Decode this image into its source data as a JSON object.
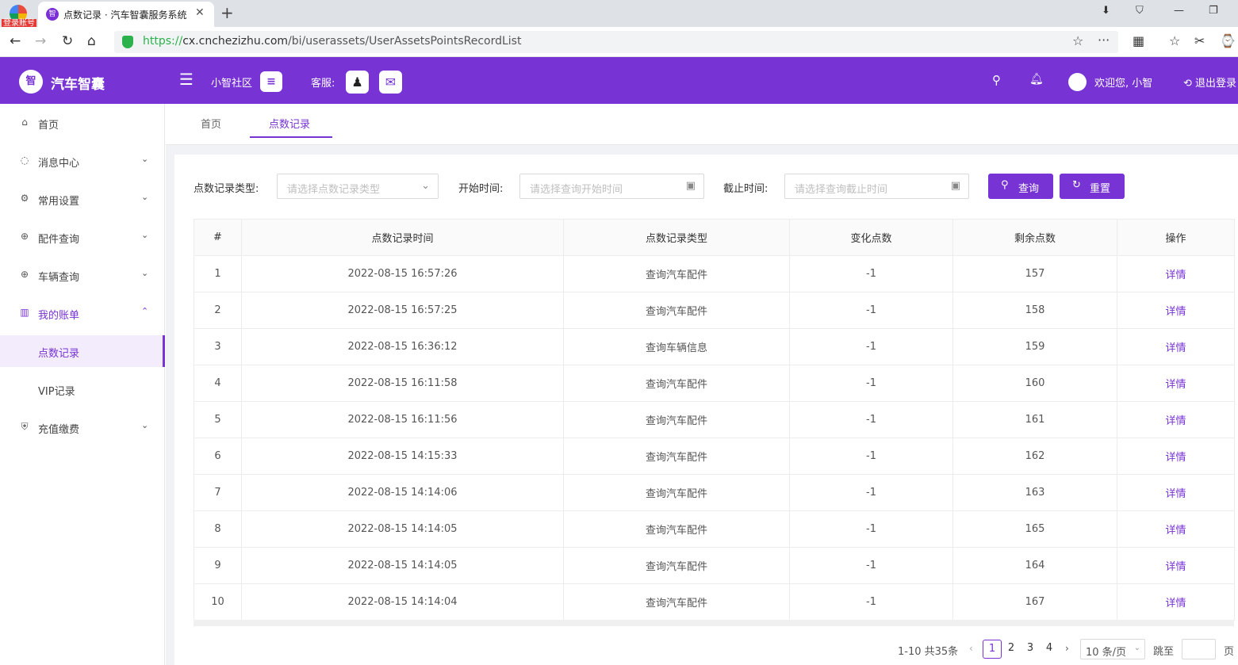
{
  "browser": {
    "login_tag": "登录账号",
    "tab_title": "点数记录 · 汽车智囊服务系统",
    "url_scheme": "https://",
    "url_host": "cx.cnchezizhu.com",
    "url_path": "/bi/userassets/UserAssetsPointsRecordList"
  },
  "header": {
    "logo_text": "智",
    "app_name": "汽车智囊",
    "community": "小智社区",
    "service": "客服:",
    "welcome": "欢迎您, 小智",
    "logout": "退出登录"
  },
  "sidebar": {
    "items": [
      {
        "label": "首页",
        "icon": "home-icon"
      },
      {
        "label": "消息中心",
        "icon": "message-icon"
      },
      {
        "label": "常用设置",
        "icon": "gear-icon"
      },
      {
        "label": "配件查询",
        "icon": "search-plus-icon"
      },
      {
        "label": "车辆查询",
        "icon": "search-plus-icon"
      },
      {
        "label": "我的账单",
        "icon": "bar-chart-icon"
      },
      {
        "label": "点数记录"
      },
      {
        "label": "VIP记录"
      },
      {
        "label": "充值缴费",
        "icon": "shield-icon"
      }
    ]
  },
  "tabs": {
    "home": "首页",
    "current": "点数记录"
  },
  "filters": {
    "type_label": "点数记录类型:",
    "type_placeholder": "请选择点数记录类型",
    "start_label": "开始时间:",
    "start_placeholder": "请选择查询开始时间",
    "end_label": "截止时间:",
    "end_placeholder": "请选择查询截止时间",
    "search_btn": "查询",
    "reset_btn": "重置"
  },
  "table": {
    "headers": [
      "#",
      "点数记录时间",
      "点数记录类型",
      "变化点数",
      "剩余点数",
      "操作"
    ],
    "rows": [
      [
        "1",
        "2022-08-15 16:57:26",
        "查询汽车配件",
        "-1",
        "157",
        "详情"
      ],
      [
        "2",
        "2022-08-15 16:57:25",
        "查询汽车配件",
        "-1",
        "158",
        "详情"
      ],
      [
        "3",
        "2022-08-15 16:36:12",
        "查询车辆信息",
        "-1",
        "159",
        "详情"
      ],
      [
        "4",
        "2022-08-15 16:11:58",
        "查询汽车配件",
        "-1",
        "160",
        "详情"
      ],
      [
        "5",
        "2022-08-15 16:11:56",
        "查询汽车配件",
        "-1",
        "161",
        "详情"
      ],
      [
        "6",
        "2022-08-15 14:15:33",
        "查询汽车配件",
        "-1",
        "162",
        "详情"
      ],
      [
        "7",
        "2022-08-15 14:14:06",
        "查询汽车配件",
        "-1",
        "163",
        "详情"
      ],
      [
        "8",
        "2022-08-15 14:14:05",
        "查询汽车配件",
        "-1",
        "165",
        "详情"
      ],
      [
        "9",
        "2022-08-15 14:14:05",
        "查询汽车配件",
        "-1",
        "164",
        "详情"
      ],
      [
        "10",
        "2022-08-15 14:14:04",
        "查询汽车配件",
        "-1",
        "167",
        "详情"
      ]
    ]
  },
  "pagination": {
    "total": "1-10 共35条",
    "pages": [
      "1",
      "2",
      "3",
      "4"
    ],
    "current": "1",
    "page_size": "10 条/页",
    "jump_label": "跳至",
    "page_label": "页"
  },
  "colors": {
    "brand": "#7733d4"
  }
}
